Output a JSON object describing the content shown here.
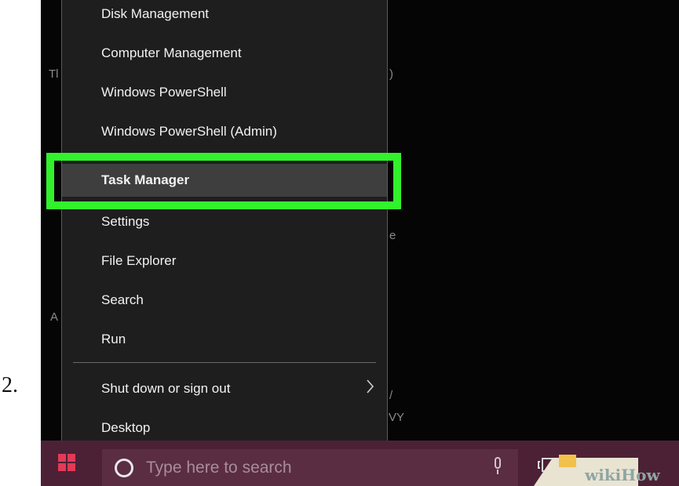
{
  "step": {
    "number": "2."
  },
  "background_fragments": [
    {
      "text": "Tl"
    },
    {
      "text": ")"
    },
    {
      "text": "e"
    },
    {
      "text": "A"
    },
    {
      "text": "/"
    },
    {
      "text": "VY"
    }
  ],
  "context_menu": {
    "items": [
      {
        "label": "Disk Management"
      },
      {
        "label": "Computer Management"
      },
      {
        "label": "Windows PowerShell"
      },
      {
        "label": "Windows PowerShell (Admin)"
      },
      {
        "label": "Task Manager",
        "selected": true
      },
      {
        "label": "Settings"
      },
      {
        "label": "File Explorer"
      },
      {
        "label": "Search"
      },
      {
        "label": "Run"
      },
      {
        "label": "Shut down or sign out",
        "submenu": true,
        "submenu_icon": "chevron-right-icon"
      },
      {
        "label": "Desktop"
      }
    ]
  },
  "taskbar": {
    "search_placeholder": "Type here to search",
    "icons": [
      "windows-start-icon",
      "search-circle-icon",
      "microphone-icon",
      "task-view-icon",
      "folder-icon"
    ]
  },
  "watermark": {
    "text": "wikiHow"
  },
  "colors": {
    "highlight": "#31f22b",
    "menu_background": "#1e1e1e",
    "taskbar_background": "#4c2136",
    "start_icon": "#e23a57"
  }
}
